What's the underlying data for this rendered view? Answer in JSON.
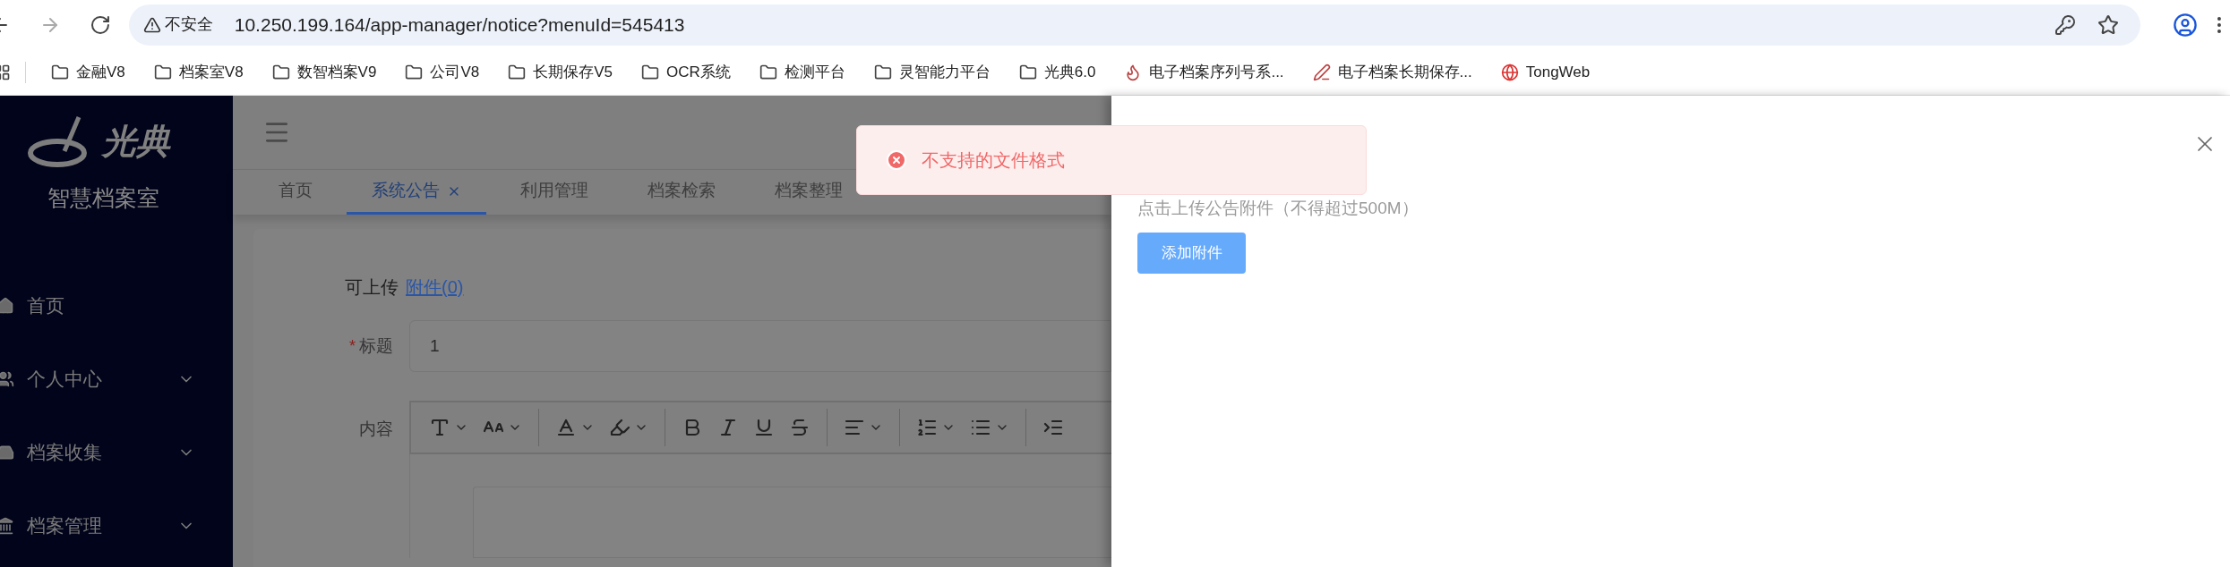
{
  "browser": {
    "security_label": "不安全",
    "url": "10.250.199.164/app-manager/notice?menuId=545413",
    "bookmarks": [
      {
        "label": "金融V8",
        "kind": "folder"
      },
      {
        "label": "档案室V8",
        "kind": "folder"
      },
      {
        "label": "数智档案V9",
        "kind": "folder"
      },
      {
        "label": "公司V8",
        "kind": "folder"
      },
      {
        "label": "长期保存V5",
        "kind": "folder"
      },
      {
        "label": "OCR系统",
        "kind": "folder"
      },
      {
        "label": "检测平台",
        "kind": "folder"
      },
      {
        "label": "灵智能力平台",
        "kind": "folder"
      },
      {
        "label": "光典6.0",
        "kind": "folder"
      },
      {
        "label": "电子档案序列号系...",
        "kind": "lamp"
      },
      {
        "label": "电子档案长期保存...",
        "kind": "logo"
      },
      {
        "label": "TongWeb",
        "kind": "web"
      }
    ]
  },
  "sidebar": {
    "logo_text": "光典",
    "title": "智慧档案室",
    "items": [
      {
        "label": "首页",
        "kind": "home",
        "expandable": false
      },
      {
        "label": "个人中心",
        "kind": "user",
        "expandable": true
      },
      {
        "label": "档案收集",
        "kind": "tray",
        "expandable": true
      },
      {
        "label": "档案管理",
        "kind": "bank",
        "expandable": true
      }
    ]
  },
  "tabs": [
    {
      "label": "首页",
      "selected": false,
      "closable": false
    },
    {
      "label": "系统公告",
      "selected": true,
      "closable": true
    },
    {
      "label": "利用管理",
      "selected": false,
      "closable": false
    },
    {
      "label": "档案检索",
      "selected": false,
      "closable": false
    },
    {
      "label": "档案整理",
      "selected": false,
      "closable": false
    }
  ],
  "form": {
    "upload_prefix": "可上传",
    "upload_link": "附件(0)",
    "title_label": "标题",
    "required_mark": "*",
    "title_value": "1",
    "content_label": "内容",
    "toolbar": [
      {
        "kind": "font-size"
      },
      {
        "kind": "font-style"
      },
      {
        "kind": "sep"
      },
      {
        "kind": "font-color"
      },
      {
        "kind": "bg-color"
      },
      {
        "kind": "sep"
      },
      {
        "kind": "bold"
      },
      {
        "kind": "italic"
      },
      {
        "kind": "underline"
      },
      {
        "kind": "strike"
      },
      {
        "kind": "sep"
      },
      {
        "kind": "align"
      },
      {
        "kind": "sep"
      },
      {
        "kind": "ordered"
      },
      {
        "kind": "bullet"
      },
      {
        "kind": "sep"
      },
      {
        "kind": "indent"
      }
    ]
  },
  "toast": {
    "kind": "error",
    "message": "不支持的文件格式"
  },
  "drawer": {
    "hint": "点击上传公告附件（不得超过500M）",
    "button": "添加附件"
  }
}
